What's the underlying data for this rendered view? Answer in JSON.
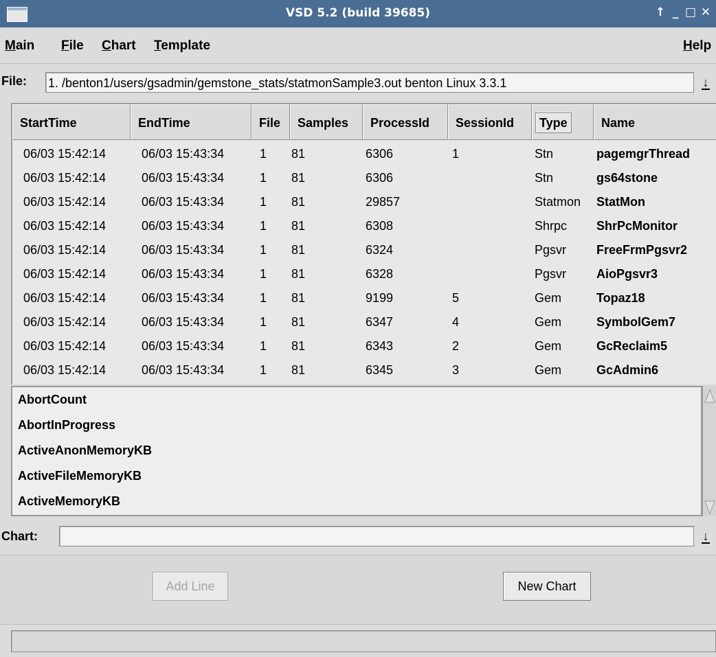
{
  "window": {
    "title": "VSD 5.2 (build 39685)",
    "controls": [
      "↑",
      "_",
      "□",
      "✕"
    ]
  },
  "menubar": {
    "items": [
      {
        "mnemonic": "M",
        "rest": "ain"
      },
      {
        "mnemonic": "F",
        "rest": "ile"
      },
      {
        "mnemonic": "C",
        "rest": "hart"
      },
      {
        "mnemonic": "T",
        "rest": "emplate"
      }
    ],
    "help": {
      "mnemonic": "H",
      "rest": "elp"
    }
  },
  "file": {
    "label": "File:",
    "value": "1. /benton1/users/gsadmin/gemstone_stats/statmonSample3.out benton Linux 3.3.1"
  },
  "table": {
    "columns": [
      "StartTime",
      "EndTime",
      "File",
      "Samples",
      "ProcessId",
      "SessionId",
      "Type",
      "Name"
    ],
    "sorted_column": "Type",
    "rows": [
      [
        "06/03 15:42:14",
        "06/03 15:43:34",
        "1",
        "81",
        "6306",
        "1",
        "Stn",
        "pagemgrThread"
      ],
      [
        "06/03 15:42:14",
        "06/03 15:43:34",
        "1",
        "81",
        "6306",
        "",
        "Stn",
        "gs64stone"
      ],
      [
        "06/03 15:42:14",
        "06/03 15:43:34",
        "1",
        "81",
        "29857",
        "",
        "Statmon",
        "StatMon"
      ],
      [
        "06/03 15:42:14",
        "06/03 15:43:34",
        "1",
        "81",
        "6308",
        "",
        "Shrpc",
        "ShrPcMonitor"
      ],
      [
        "06/03 15:42:14",
        "06/03 15:43:34",
        "1",
        "81",
        "6324",
        "",
        "Pgsvr",
        "FreeFrmPgsvr2"
      ],
      [
        "06/03 15:42:14",
        "06/03 15:43:34",
        "1",
        "81",
        "6328",
        "",
        "Pgsvr",
        "AioPgsvr3"
      ],
      [
        "06/03 15:42:14",
        "06/03 15:43:34",
        "1",
        "81",
        "9199",
        "5",
        "Gem",
        "Topaz18"
      ],
      [
        "06/03 15:42:14",
        "06/03 15:43:34",
        "1",
        "81",
        "6347",
        "4",
        "Gem",
        "SymbolGem7"
      ],
      [
        "06/03 15:42:14",
        "06/03 15:43:34",
        "1",
        "81",
        "6343",
        "2",
        "Gem",
        "GcReclaim5"
      ],
      [
        "06/03 15:42:14",
        "06/03 15:43:34",
        "1",
        "81",
        "6345",
        "3",
        "Gem",
        "GcAdmin6"
      ]
    ]
  },
  "stats": [
    "AbortCount",
    "AbortInProgress",
    "ActiveAnonMemoryKB",
    "ActiveFileMemoryKB",
    "ActiveMemoryKB"
  ],
  "chart": {
    "label": "Chart:",
    "value": ""
  },
  "buttons": {
    "add_line": "Add Line",
    "new_chart": "New Chart"
  },
  "status": "",
  "colors": {
    "titlebar": "#4a6d94",
    "background": "#dcdcdc"
  }
}
